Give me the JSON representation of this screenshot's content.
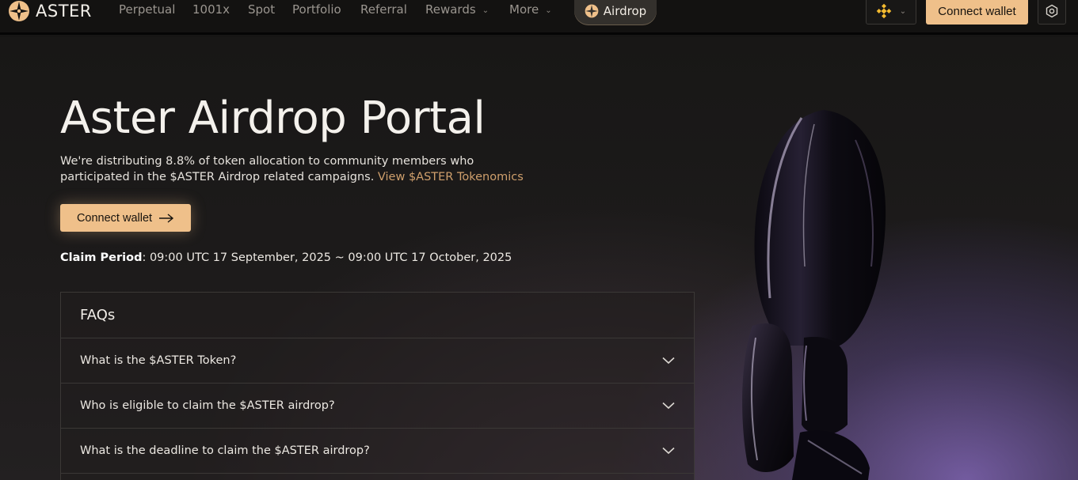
{
  "brand": {
    "name": "ASTER"
  },
  "nav": {
    "items": [
      {
        "label": "Perpetual"
      },
      {
        "label": "1001x"
      },
      {
        "label": "Spot"
      },
      {
        "label": "Portfolio"
      },
      {
        "label": "Referral"
      },
      {
        "label": "Rewards",
        "dropdown": true
      },
      {
        "label": "More",
        "dropdown": true
      }
    ],
    "airdrop_label": "Airdrop",
    "chain_icon": "bnb-chain-icon",
    "connect_label": "Connect wallet",
    "settings_icon": "settings-icon"
  },
  "hero": {
    "title": "Aster Airdrop Portal",
    "description": "We're distributing 8.8% of token allocation to community members who participated in the $ASTER Airdrop related campaigns.",
    "tokenomics_link": "View $ASTER Tokenomics",
    "connect_label": "Connect wallet",
    "claim_label": "Claim Period",
    "claim_value": ": 09:00 UTC 17 September, 2025 ~ 09:00 UTC 17 October, 2025"
  },
  "faq": {
    "title": "FAQs",
    "items": [
      {
        "question": "What is the $ASTER Token?"
      },
      {
        "question": "Who is eligible to claim the $ASTER airdrop?"
      },
      {
        "question": "What is the deadline to claim the $ASTER airdrop?"
      }
    ]
  },
  "colors": {
    "accent": "#efc08a",
    "link": "#cf9f6c",
    "background": "#161514",
    "bnb": "#f3ba2f"
  }
}
